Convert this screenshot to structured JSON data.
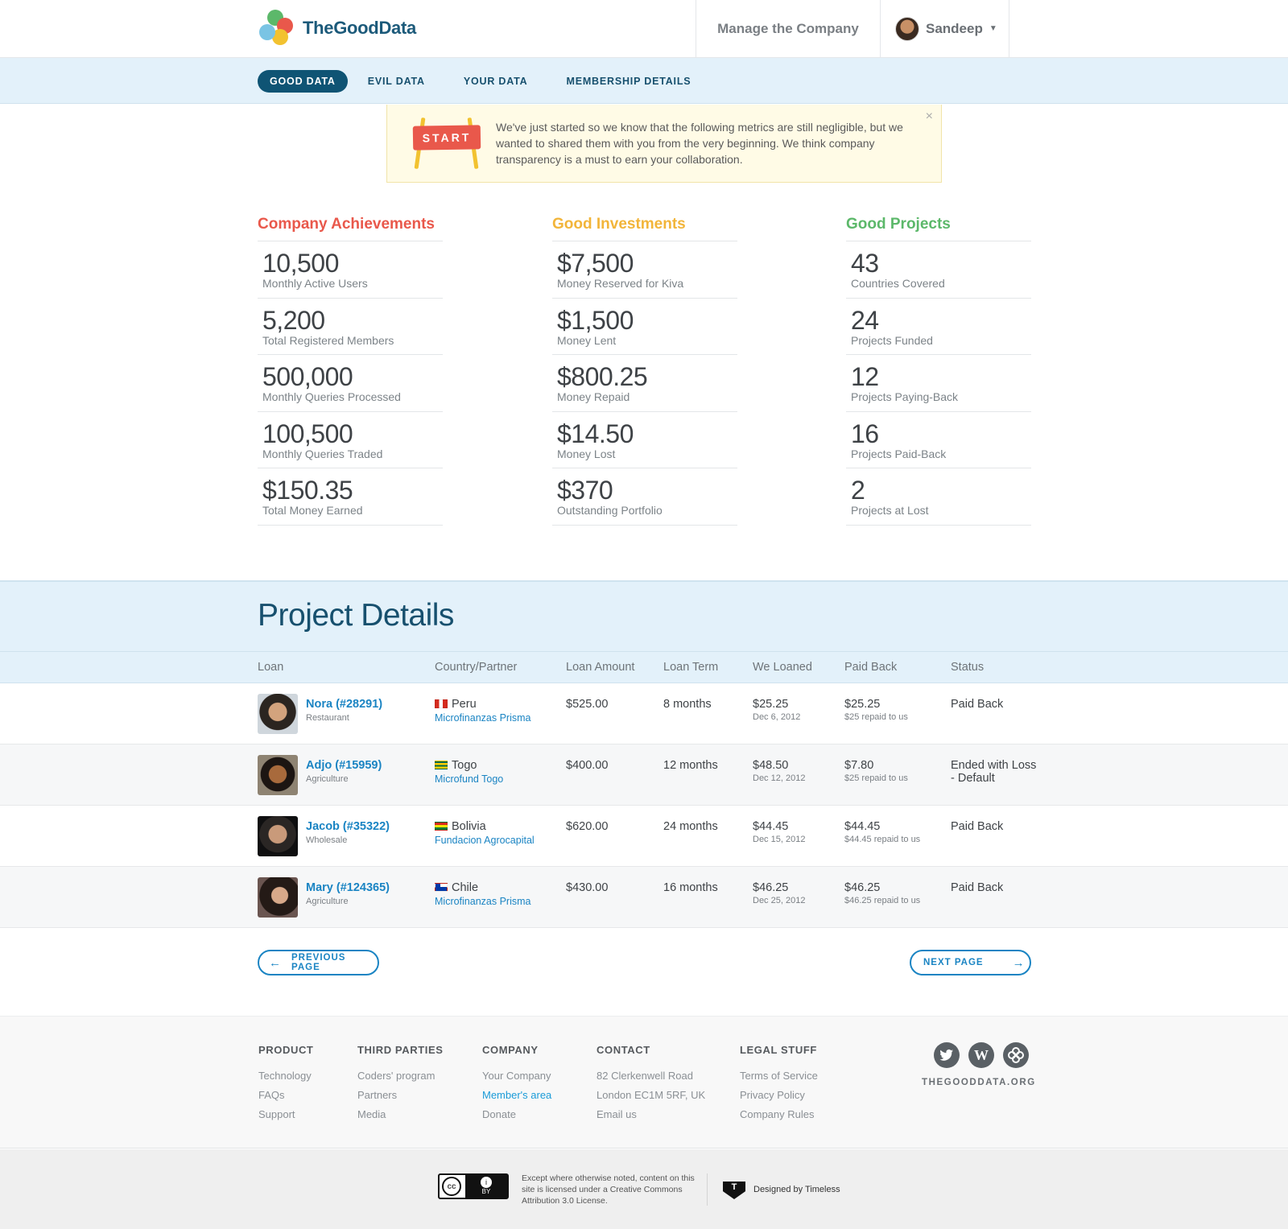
{
  "brand": {
    "name": "TheGoodData"
  },
  "header": {
    "manage_label": "Manage the Company",
    "user_name": "Sandeep"
  },
  "nav": [
    {
      "label": "GOOD DATA",
      "active": true
    },
    {
      "label": "EVIL DATA",
      "active": false
    },
    {
      "label": "YOUR DATA",
      "active": false
    },
    {
      "label": "MEMBERSHIP DETAILS",
      "active": false
    }
  ],
  "notice": {
    "sign": "START",
    "text": "We've just started so we know that the following metrics are still negligible, but we wanted to shared them with you from the very beginning. We think company transparency is a must to earn your collaboration.",
    "close": "×"
  },
  "stats": [
    {
      "title": "Company Achievements",
      "color": "#e9584b",
      "items": [
        {
          "value": "10,500",
          "label": "Monthly Active Users"
        },
        {
          "value": "5,200",
          "label": "Total Registered Members"
        },
        {
          "value": "500,000",
          "label": "Monthly Queries Processed"
        },
        {
          "value": "100,500",
          "label": "Monthly Queries Traded"
        },
        {
          "value": "$150.35",
          "label": "Total Money Earned"
        }
      ]
    },
    {
      "title": "Good Investments",
      "color": "#f2b53a",
      "items": [
        {
          "value": "$7,500",
          "label": "Money Reserved for Kiva"
        },
        {
          "value": "$1,500",
          "label": "Money Lent"
        },
        {
          "value": "$800.25",
          "label": "Money Repaid"
        },
        {
          "value": "$14.50",
          "label": "Money Lost"
        },
        {
          "value": "$370",
          "label": "Outstanding Portfolio"
        }
      ]
    },
    {
      "title": "Good Projects",
      "color": "#5cb86a",
      "items": [
        {
          "value": "43",
          "label": "Countries Covered"
        },
        {
          "value": "24",
          "label": "Projects Funded"
        },
        {
          "value": "12",
          "label": "Projects Paying-Back"
        },
        {
          "value": "16",
          "label": "Projects Paid-Back"
        },
        {
          "value": "2",
          "label": "Projects at Lost"
        }
      ]
    }
  ],
  "project_details": {
    "title": "Project Details",
    "columns": [
      "Loan",
      "Country/Partner",
      "Loan Amount",
      "Loan Term",
      "We Loaned",
      "Paid Back",
      "Status"
    ],
    "rows": [
      {
        "name": "Nora (#28291)",
        "sector": "Restaurant",
        "country": "Peru",
        "partner": "Microfinanzas Prisma",
        "amount": "$525.00",
        "term": "8 months",
        "loaned": "$25.25",
        "loaned_date": "Dec 6, 2012",
        "paid": "$25.25",
        "paid_note": "$25 repaid to us",
        "status": "Paid Back"
      },
      {
        "name": "Adjo (#15959)",
        "sector": "Agriculture",
        "country": "Togo",
        "partner": "Microfund Togo",
        "amount": "$400.00",
        "term": "12 months",
        "loaned": "$48.50",
        "loaned_date": "Dec 12, 2012",
        "paid": "$7.80",
        "paid_note": "$25 repaid to us",
        "status": "Ended with Loss - Default"
      },
      {
        "name": "Jacob (#35322)",
        "sector": "Wholesale",
        "country": "Bolivia",
        "partner": "Fundacion Agrocapital",
        "amount": "$620.00",
        "term": "24 months",
        "loaned": "$44.45",
        "loaned_date": "Dec 15, 2012",
        "paid": "$44.45",
        "paid_note": "$44.45 repaid to us",
        "status": "Paid Back"
      },
      {
        "name": "Mary (#124365)",
        "sector": "Agriculture",
        "country": "Chile",
        "partner": "Microfinanzas Prisma",
        "amount": "$430.00",
        "term": "16 months",
        "loaned": "$46.25",
        "loaned_date": "Dec 25, 2012",
        "paid": "$46.25",
        "paid_note": "$46.25 repaid to us",
        "status": "Paid Back"
      }
    ]
  },
  "pager": {
    "prev": "PREVIOUS PAGE",
    "next": "NEXT PAGE"
  },
  "footer": {
    "columns": [
      {
        "title": "PRODUCT",
        "links": [
          "Technology",
          "FAQs",
          "Support"
        ]
      },
      {
        "title": "THIRD PARTIES",
        "links": [
          "Coders' program",
          "Partners",
          "Media"
        ]
      },
      {
        "title": "COMPANY",
        "links": [
          "Your Company",
          "Member's area",
          "Donate"
        ]
      },
      {
        "title": "CONTACT",
        "links": [
          "82 Clerkenwell Road",
          "London EC1M 5RF, UK",
          "Email us"
        ]
      },
      {
        "title": "LEGAL STUFF",
        "links": [
          "Terms of Service",
          "Privacy Policy",
          "Company Rules"
        ]
      }
    ],
    "social": [
      "twitter-icon",
      "wordpress-icon",
      "thegooddata-icon"
    ],
    "domain": "THEGOODDATA.ORG",
    "license_text": "Except where otherwise noted, content on this site is licensed under a Creative Commons Attribution 3.0 License.",
    "cc_badge": {
      "cc": "cc",
      "by": "BY"
    },
    "designed_by": "Designed by Timeless",
    "designer_mark": "T"
  }
}
